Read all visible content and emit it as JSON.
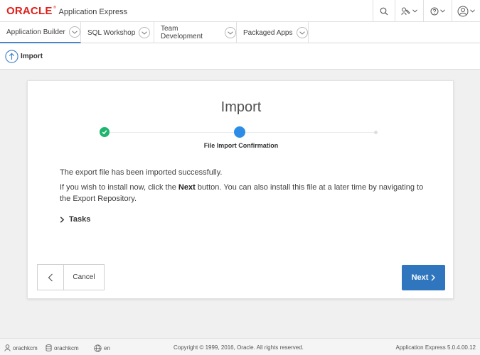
{
  "header": {
    "brand": "ORACLE",
    "brand_mark": "®",
    "app_name": "Application Express",
    "icons": [
      "search-icon",
      "user-admin-icon",
      "help-icon",
      "user-menu-icon"
    ]
  },
  "tabs": [
    {
      "label": "Application Builder",
      "active": true
    },
    {
      "label": "SQL Workshop",
      "active": false
    },
    {
      "label": "Team Development",
      "active": false
    },
    {
      "label": "Packaged Apps",
      "active": false
    }
  ],
  "breadcrumb": {
    "label": "Import",
    "icon": "arrow-up-circle-icon"
  },
  "wizard": {
    "title": "Import",
    "current_step_label": "File Import Confirmation",
    "steps": [
      "complete",
      "current",
      "pending"
    ],
    "message_1": "The export file has been imported successfully.",
    "message_2_before": "If you wish to install now, click the ",
    "message_2_bold": "Next",
    "message_2_after": " button. You can also install this file at a later time by navigating to the Export Repository.",
    "tasks_label": "Tasks",
    "cancel_label": "Cancel",
    "next_label": "Next"
  },
  "footer": {
    "user": "orachkcm",
    "workspace": "orachkcm",
    "language": "en",
    "copyright": "Copyright © 1999, 2016, Oracle. All rights reserved.",
    "version": "Application Express 5.0.4.00.12"
  },
  "colors": {
    "brand_red": "#e0201b",
    "accent_blue": "#2f76bf",
    "step_current": "#2d8de6",
    "step_done": "#1fb56e"
  }
}
